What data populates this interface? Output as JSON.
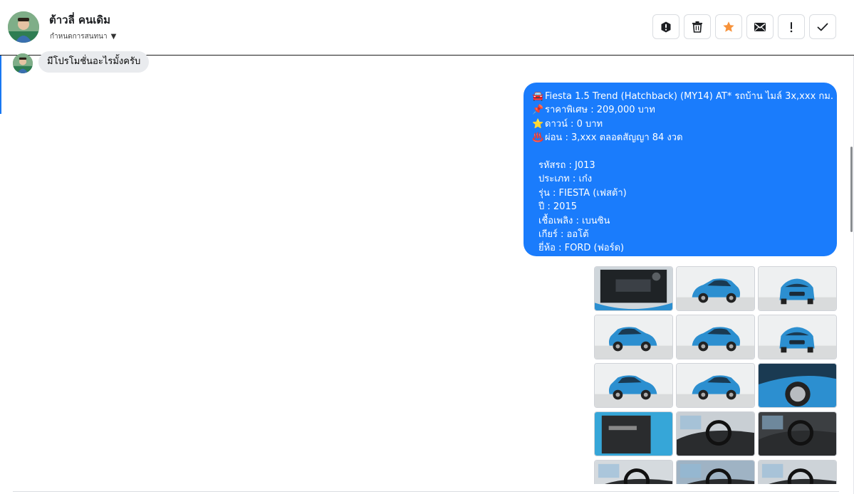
{
  "conversation": {
    "contact_name": "ต้าวลี่ คนเดิม",
    "status_label": "กำหนดการสนทนา",
    "status_icon": "caret-down-icon"
  },
  "toolbar": {
    "buttons": [
      {
        "name": "report-spam-button",
        "icon": "alert-circle-icon"
      },
      {
        "name": "delete-button",
        "icon": "trash-icon"
      },
      {
        "name": "star-button",
        "icon": "star-icon",
        "color": "#f7923a"
      },
      {
        "name": "mark-unread-button",
        "icon": "envelope-icon"
      },
      {
        "name": "follow-up-button",
        "icon": "exclamation-icon"
      },
      {
        "name": "mark-done-button",
        "icon": "check-icon"
      }
    ]
  },
  "messages": {
    "incoming": {
      "text": "มีโปรโมชั่นอะไรมั้งครับ"
    },
    "outgoing": {
      "color": "#1a7cfc",
      "lines": [
        {
          "icon": "🚘",
          "text": "Fiesta 1.5 Trend (Hatchback) (MY14) AT* รถบ้าน ไมล์ 3x,xxx กม."
        },
        {
          "icon": "📌",
          "text": "ราคาพิเศษ : 209,000 บาท"
        },
        {
          "icon": "⭐",
          "text": "ดาวน์ : 0 บาท"
        },
        {
          "icon": "♨️",
          "text": "ผ่อน : 3,xxx ตลอดสัญญา 84 งวด"
        }
      ],
      "specs": [
        "รหัสรถ : J013",
        "ประเภท : เก๋ง",
        "รุ่น : FIESTA (เฟสต้า)",
        "ปี : 2015",
        "เชื้อเพลิง : เบนซิน",
        "เกียร์ : ออโต้",
        "ยี่ห้อ : FORD (ฟอร์ด)"
      ]
    },
    "photos": [
      {
        "name": "photo-engine-bay"
      },
      {
        "name": "photo-front-left"
      },
      {
        "name": "photo-front"
      },
      {
        "name": "photo-front-left-low"
      },
      {
        "name": "photo-rear-left"
      },
      {
        "name": "photo-rear"
      },
      {
        "name": "photo-rear-left-angle"
      },
      {
        "name": "photo-side"
      },
      {
        "name": "photo-wheel-closeup"
      },
      {
        "name": "photo-door-panel"
      },
      {
        "name": "photo-dashboard"
      },
      {
        "name": "photo-center-console"
      },
      {
        "name": "photo-dash-wide"
      },
      {
        "name": "photo-steering"
      },
      {
        "name": "photo-cabin"
      }
    ]
  }
}
